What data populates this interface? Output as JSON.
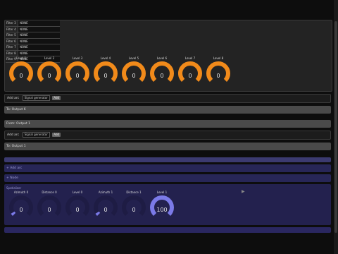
{
  "filters": [
    {
      "label": "Filter 3",
      "value": "NONE"
    },
    {
      "label": "Filter 4",
      "value": "NONE"
    },
    {
      "label": "Filter 5",
      "value": "NONE"
    },
    {
      "label": "Filter 6",
      "value": "NONE"
    },
    {
      "label": "Filter 7",
      "value": "NONE"
    },
    {
      "label": "Filter 8",
      "value": "NONE"
    },
    {
      "label": "Filter 9",
      "value": "NONE"
    }
  ],
  "top_knobs": [
    {
      "label": "Level 1",
      "value": "0"
    },
    {
      "label": "Level 2",
      "value": "0"
    },
    {
      "label": "Level 3",
      "value": "0"
    },
    {
      "label": "Level 4",
      "value": "0"
    },
    {
      "label": "Level 5",
      "value": "0"
    },
    {
      "label": "Level 6",
      "value": "0"
    },
    {
      "label": "Level 7",
      "value": "0"
    },
    {
      "label": "Level 8",
      "value": "0"
    }
  ],
  "rows": {
    "add_arc_1": {
      "label": "Add arc",
      "input": "Signal generator",
      "button": "Add"
    },
    "output_6": "To: Output 6",
    "output_1_a": "From: Output 1",
    "add_arc_2": {
      "label": "Add arc",
      "input": "Signal generator",
      "button": "Add"
    },
    "output_1_b": "To: Output 1",
    "purple_1": "",
    "purple_2": "+ Add arc",
    "purple_3": "+ Node"
  },
  "bottom": {
    "title": "Spatializer",
    "knobs": [
      {
        "label": "Azimuth 0",
        "value": "0",
        "level": 0.05
      },
      {
        "label": "Distance 0",
        "value": "0",
        "level": 0
      },
      {
        "label": "Level 0",
        "value": "0",
        "level": 0
      },
      {
        "label": "Azimuth 1",
        "value": "0",
        "level": 0.05
      },
      {
        "label": "Distance 1",
        "value": "0",
        "level": 0
      },
      {
        "label": "Level 1",
        "value": "100",
        "level": 1
      }
    ]
  },
  "colors": {
    "orange": "#f18a1a",
    "knob_track": "#3a3a3a",
    "purple_knob": "#7b7ae8",
    "purple_track": "#1e1c44"
  }
}
